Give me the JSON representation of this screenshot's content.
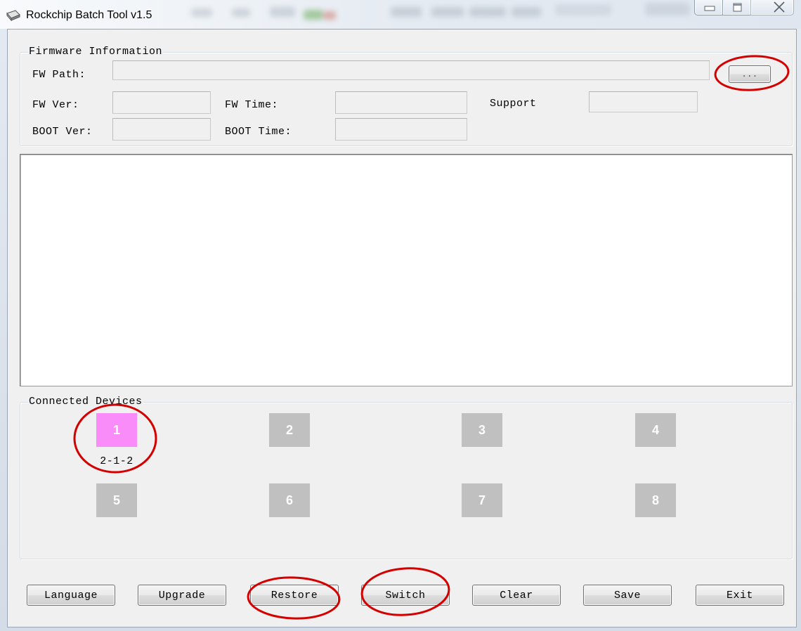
{
  "window": {
    "title": "Rockchip Batch Tool v1.5",
    "app_icon": "app-icon",
    "minimize_icon": "minimize-icon",
    "maximize_icon": "maximize-icon",
    "close_icon": "close-icon"
  },
  "firmware_info": {
    "group_label": "Firmware Information",
    "fw_path": {
      "label": "FW Path:",
      "value": ""
    },
    "browse_button": {
      "label": "..."
    },
    "fw_ver": {
      "label": "FW Ver:",
      "value": ""
    },
    "fw_time": {
      "label": "FW Time:",
      "value": ""
    },
    "support": {
      "label": "Support",
      "value": ""
    },
    "boot_ver": {
      "label": "BOOT Ver:",
      "value": ""
    },
    "boot_time": {
      "label": "BOOT Time:",
      "value": ""
    }
  },
  "log": {
    "text": ""
  },
  "connected_devices": {
    "group_label": "Connected Devices",
    "status_colors": {
      "connected": "#f98cf8",
      "not_connected": "#c0c0c0",
      "number_text": "#ffffff"
    },
    "devices": [
      {
        "number": "1",
        "connected": true,
        "location": "2-1-2"
      },
      {
        "number": "2",
        "connected": false
      },
      {
        "number": "3",
        "connected": false
      },
      {
        "number": "4",
        "connected": false
      },
      {
        "number": "5",
        "connected": false
      },
      {
        "number": "6",
        "connected": false
      },
      {
        "number": "7",
        "connected": false
      },
      {
        "number": "8",
        "connected": false
      }
    ]
  },
  "buttons": {
    "language": "Language",
    "upgrade": "Upgrade",
    "restore": "Restore",
    "switch": "Switch",
    "clear": "Clear",
    "save": "Save",
    "exit": "Exit"
  },
  "annotation_color": "#d40000"
}
